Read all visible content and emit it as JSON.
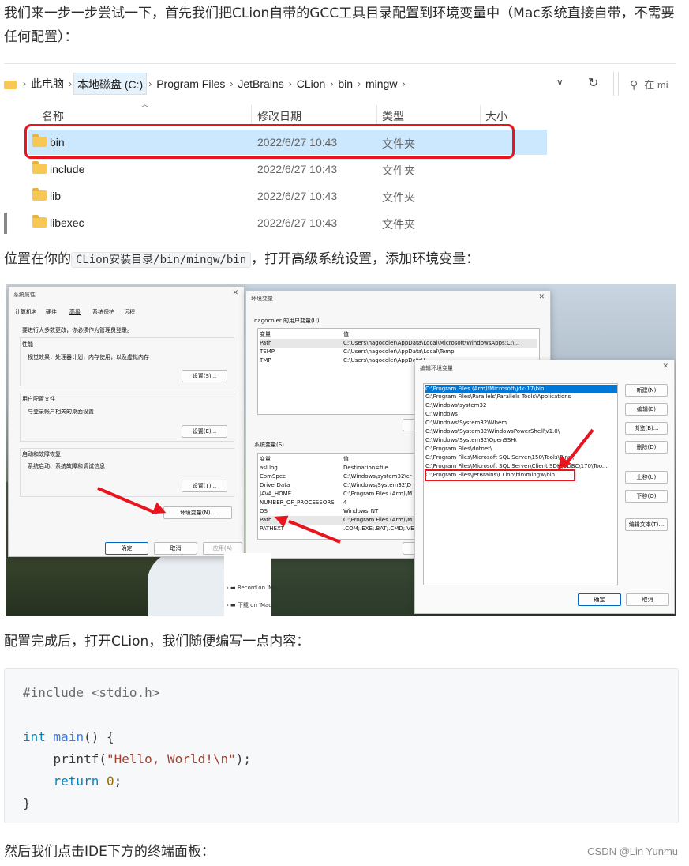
{
  "intro_text": "我们来一步一步尝试一下，首先我们把CLion自带的GCC工具目录配置到环境变量中（Mac系统直接自带，不需要任何配置）：",
  "explorer": {
    "breadcrumbs": [
      "此电脑",
      "本地磁盘 (C:)",
      "Program Files",
      "JetBrains",
      "CLion",
      "bin",
      "mingw"
    ],
    "search_placeholder": "在 mi",
    "columns": [
      "名称",
      "修改日期",
      "类型",
      "大小"
    ],
    "rows": [
      {
        "name": "bin",
        "date": "2022/6/27 10:43",
        "type": "文件夹"
      },
      {
        "name": "include",
        "date": "2022/6/27 10:43",
        "type": "文件夹"
      },
      {
        "name": "lib",
        "date": "2022/6/27 10:43",
        "type": "文件夹"
      },
      {
        "name": "libexec",
        "date": "2022/6/27 10:43",
        "type": "文件夹"
      }
    ]
  },
  "location_text": {
    "prefix": "位置在你的",
    "code": "CLion安装目录/bin/mingw/bin",
    "suffix": "，打开高级系统设置，添加环境变量："
  },
  "sys_props": {
    "title": "系统属性",
    "tabs": [
      "计算机名",
      "硬件",
      "高级",
      "系统保护",
      "远程"
    ],
    "admin_note": "要进行大多数更改，你必须作为管理员登录。",
    "perf_title": "性能",
    "perf_desc": "视觉效果，处理器计划，内存使用，以及虚拟内存",
    "profile_title": "用户配置文件",
    "profile_desc": "与登录帐户相关的桌面设置",
    "startup_title": "启动和故障恢复",
    "startup_desc": "系统启动、系统故障和调试信息",
    "settings_s": "设置(S)...",
    "settings_e": "设置(E)...",
    "settings_t": "设置(T)...",
    "env_button": "环境变量(N)...",
    "ok": "确定",
    "cancel": "取消",
    "apply": "应用(A)"
  },
  "env_vars": {
    "title": "环境变量",
    "user_section": "nagocoler 的用户变量(U)",
    "col_var": "变量",
    "col_val": "值",
    "user_rows": [
      {
        "var": "Path",
        "val": "C:\\Users\\nagocoler\\AppData\\Local\\Microsoft\\WindowsApps;C:\\..."
      },
      {
        "var": "TEMP",
        "val": "C:\\Users\\nagocoler\\AppData\\Local\\Temp"
      },
      {
        "var": "TMP",
        "val": "C:\\Users\\nagocoler\\AppData\\L"
      }
    ],
    "sys_section": "系统变量(S)",
    "sys_rows": [
      {
        "var": "asl.log",
        "val": "Destination=file"
      },
      {
        "var": "ComSpec",
        "val": "C:\\Windows\\system32\\cr"
      },
      {
        "var": "DriverData",
        "val": "C:\\Windows\\System32\\D"
      },
      {
        "var": "JAVA_HOME",
        "val": "C:\\Program Files (Arm)\\M"
      },
      {
        "var": "NUMBER_OF_PROCESSORS",
        "val": "4"
      },
      {
        "var": "OS",
        "val": "Windows_NT"
      },
      {
        "var": "Path",
        "val": "C:\\Program Files (Arm)\\M"
      },
      {
        "var": "PATHEXT",
        "val": ".COM;.EXE;.BAT;.CMD;.VE"
      }
    ],
    "btn_new_partial": "新",
    "btn_del_partial": "删"
  },
  "edit_env": {
    "title": "编辑环境变量",
    "entries": [
      "C:\\Program Files (Arm)\\Microsoft\\jdk-17\\bin",
      "C:\\Program Files\\Parallels\\Parallels Tools\\Applications",
      "C:\\Windows\\system32",
      "C:\\Windows",
      "C:\\Windows\\System32\\Wbem",
      "C:\\Windows\\System32\\WindowsPowerShell\\v1.0\\",
      "C:\\Windows\\System32\\OpenSSH\\",
      "C:\\Program Files\\dotnet\\",
      "C:\\Program Files\\Microsoft SQL Server\\150\\Tools\\Binn\\",
      "C:\\Program Files\\Microsoft SQL Server\\Client SDK\\ODBC\\170\\Too...",
      "C:\\Program Files\\JetBrains\\CLion\\bin\\mingw\\bin"
    ],
    "buttons": [
      "新建(N)",
      "编辑(E)",
      "浏览(B)...",
      "删除(D)",
      "上移(U)",
      "下移(O)",
      "编辑文本(T)..."
    ],
    "ok": "确定",
    "cancel": "取消"
  },
  "tree_items": [
    "Record on 'Ma",
    "下载 on 'Mac' ("
  ],
  "after_config_text": "配置完成后，打开CLion，我们随便编写一点内容：",
  "code": {
    "include": "#include <stdio.h>",
    "int_kw": "int",
    "main_fn": "main",
    "main_rest": "() {",
    "printf_fn": "printf",
    "printf_open": "(",
    "printf_str": "\"Hello, World!\\n\"",
    "printf_close": ");",
    "return_kw": "return",
    "return_val": "0",
    "return_end": ";",
    "close_brace": "}"
  },
  "final_text": "然后我们点击IDE下方的终端面板：",
  "watermark": "CSDN @Lin Yunmu"
}
